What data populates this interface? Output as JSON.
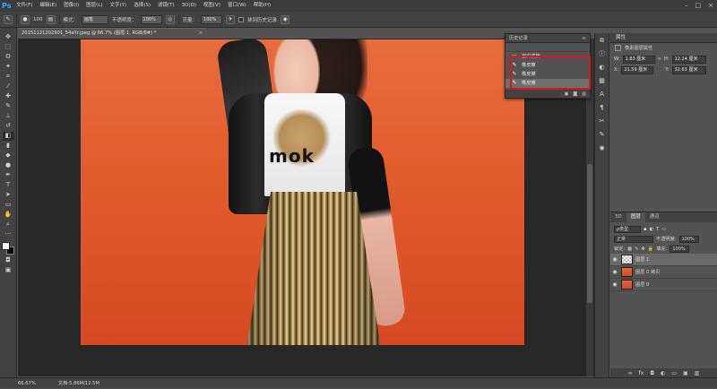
{
  "menubar": {
    "logo": "Ps",
    "items": [
      "文件(F)",
      "编辑(E)",
      "图像(I)",
      "图层(L)",
      "文字(Y)",
      "选择(S)",
      "滤镜(T)",
      "3D(D)",
      "视图(V)",
      "窗口(W)",
      "帮助(H)"
    ],
    "window_buttons": [
      "–",
      "□",
      "×"
    ]
  },
  "options": {
    "brush_size": "100",
    "mode_label": "模式：",
    "mode_value": "画笔",
    "opacity_label": "不透明度：",
    "opacity_value": "100%",
    "flow_label": "流量：",
    "flow_value": "100%",
    "erase_history_label": "抹到历史记录"
  },
  "document_tab": {
    "title": "20151121202901_54aYr.jpeg @ 66.7% (图层 1, RGB/8#) *",
    "close": "×"
  },
  "history": {
    "title": "历史记录",
    "menu": "≡",
    "items": [
      {
        "label": "自由变换",
        "icon": "transform-icon"
      },
      {
        "label": "橡皮擦",
        "icon": "eraser-icon"
      },
      {
        "label": "橡皮擦",
        "icon": "eraser-icon"
      },
      {
        "label": "橡皮擦",
        "icon": "eraser-icon"
      }
    ]
  },
  "properties": {
    "tab": "属性",
    "subtitle": "像素图层属性",
    "w_label": "W:",
    "w_value": "1.83 厘米",
    "h_label": "H:",
    "h_value": "12.24 厘米",
    "x_label": "X:",
    "x_value": "21.59 厘米",
    "y_label": "Y:",
    "y_value": "32.63 厘米"
  },
  "layers": {
    "tabs": [
      "3D",
      "图层",
      "通道"
    ],
    "filter_label": "ρ类型",
    "blend_mode": "正常",
    "opacity_label": "不透明度:",
    "opacity_value": "100%",
    "lock_label": "锁定:",
    "fill_label": "填充:",
    "fill_value": "100%",
    "items": [
      {
        "name": "图层 1",
        "thumb": "transparent"
      },
      {
        "name": "图层 0 拷贝",
        "thumb": "photo"
      },
      {
        "name": "图层 0",
        "thumb": "photo"
      }
    ]
  },
  "status": {
    "zoom": "66.67%",
    "doc": "文档:5.86M/12.5M"
  },
  "photo": {
    "tshirt_text": "mok"
  }
}
